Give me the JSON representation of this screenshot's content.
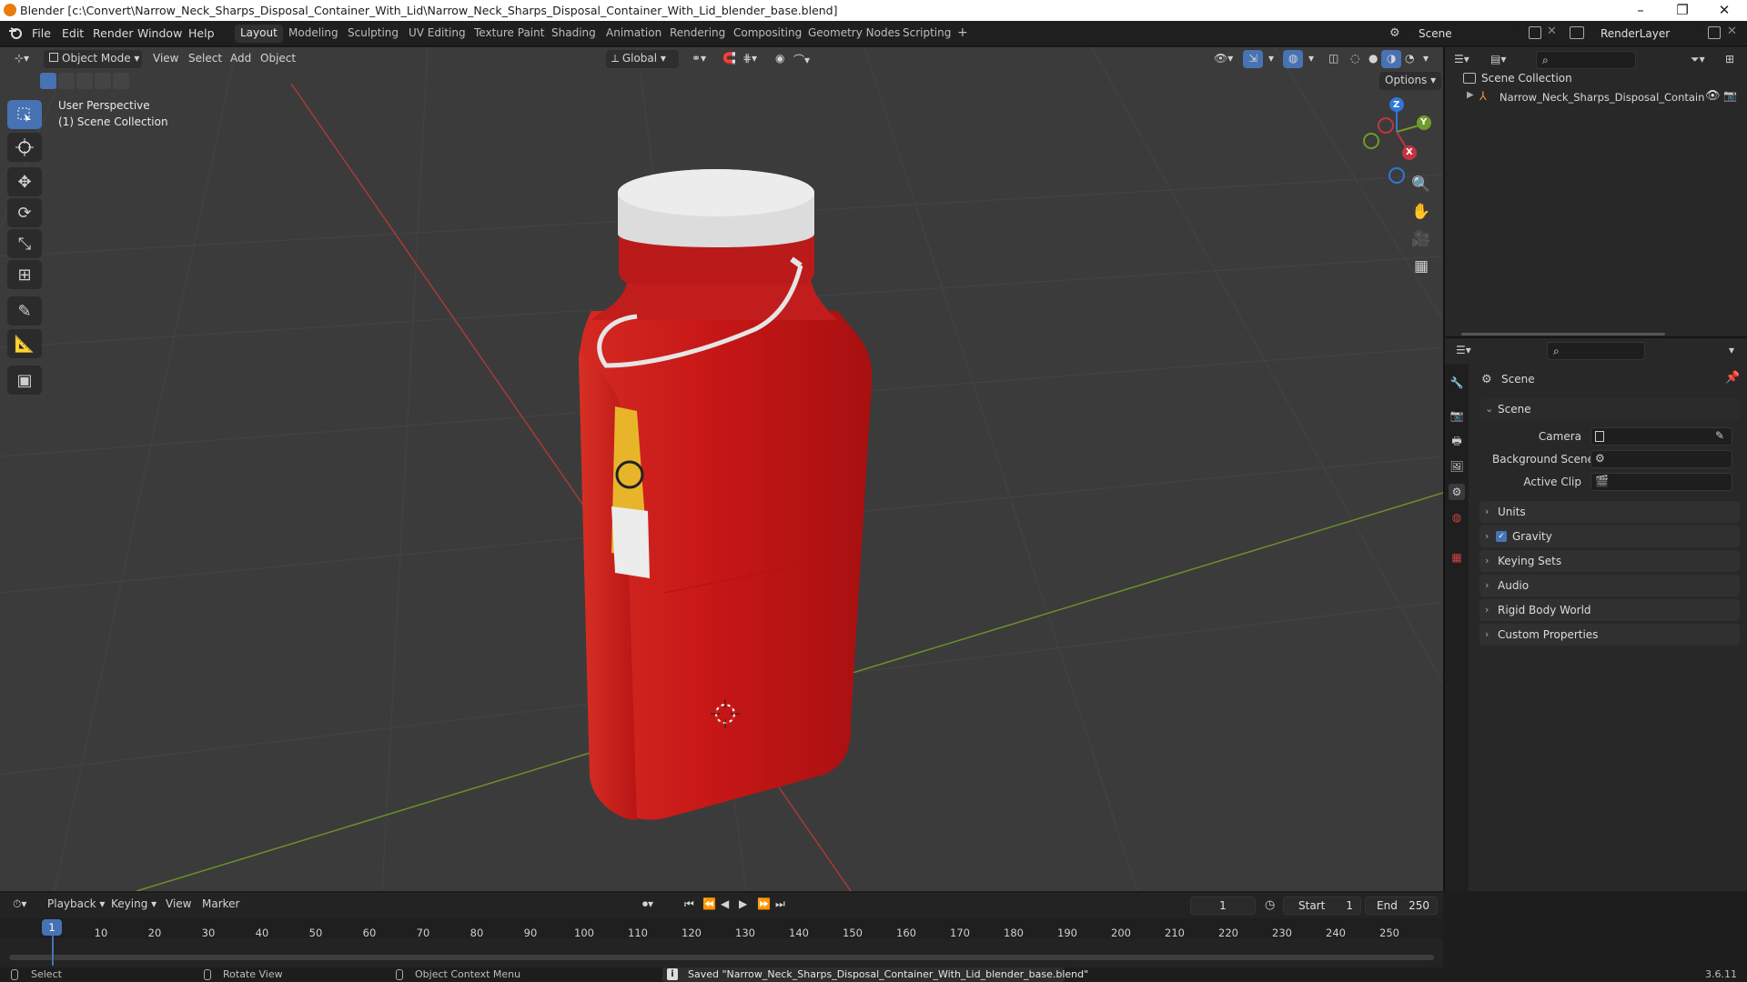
{
  "window": {
    "title": "Blender [c:\\Convert\\Narrow_Neck_Sharps_Disposal_Container_With_Lid\\Narrow_Neck_Sharps_Disposal_Container_With_Lid_blender_base.blend]",
    "minimize": "–",
    "maximize": "❐",
    "close": "✕"
  },
  "menus": [
    "File",
    "Edit",
    "Render",
    "Window",
    "Help"
  ],
  "workspaces": [
    "Layout",
    "Modeling",
    "Sculpting",
    "UV Editing",
    "Texture Paint",
    "Shading",
    "Animation",
    "Rendering",
    "Compositing",
    "Geometry Nodes",
    "Scripting"
  ],
  "workspace_add": "+",
  "scene_field": "Scene",
  "renderlayer_field": "RenderLayer",
  "viewport_header": {
    "mode": "Object Mode",
    "menus": [
      "View",
      "Select",
      "Add",
      "Object"
    ],
    "orientation": "Global",
    "options": "Options"
  },
  "viewport": {
    "perspective": "User Perspective",
    "collection": "(1) Scene Collection",
    "gizmo": {
      "x": "X",
      "y": "Y",
      "z": "Z"
    }
  },
  "outliner": {
    "root": "Scene Collection",
    "item": "Narrow_Neck_Sharps_Disposal_Contain"
  },
  "properties": {
    "header": "Scene",
    "section": "Scene",
    "camera_label": "Camera",
    "background_label": "Background Scene",
    "clip_label": "Active Clip",
    "panels": [
      "Units",
      "Gravity",
      "Keying Sets",
      "Audio",
      "Rigid Body World",
      "Custom Properties"
    ],
    "gravity_checked": true
  },
  "timeline": {
    "menus": [
      "Playback",
      "Keying",
      "View",
      "Marker"
    ],
    "current_frame": "1",
    "start_label": "Start",
    "start": "1",
    "end_label": "End",
    "end": "250",
    "ticks": [
      "1",
      "10",
      "20",
      "30",
      "40",
      "50",
      "60",
      "70",
      "80",
      "90",
      "100",
      "110",
      "120",
      "130",
      "140",
      "150",
      "160",
      "170",
      "180",
      "190",
      "200",
      "210",
      "220",
      "230",
      "240",
      "250"
    ]
  },
  "status": {
    "select": "Select",
    "rotate": "Rotate View",
    "context": "Object Context Menu",
    "message": "Saved \"Narrow_Neck_Sharps_Disposal_Container_With_Lid_blender_base.blend\"",
    "version": "3.6.11"
  },
  "colors": {
    "accent": "#4772b3",
    "x_axis": "#c4343f",
    "y_axis": "#6f9b2a",
    "z_axis": "#2f78d9",
    "container": "#c81a1a"
  }
}
